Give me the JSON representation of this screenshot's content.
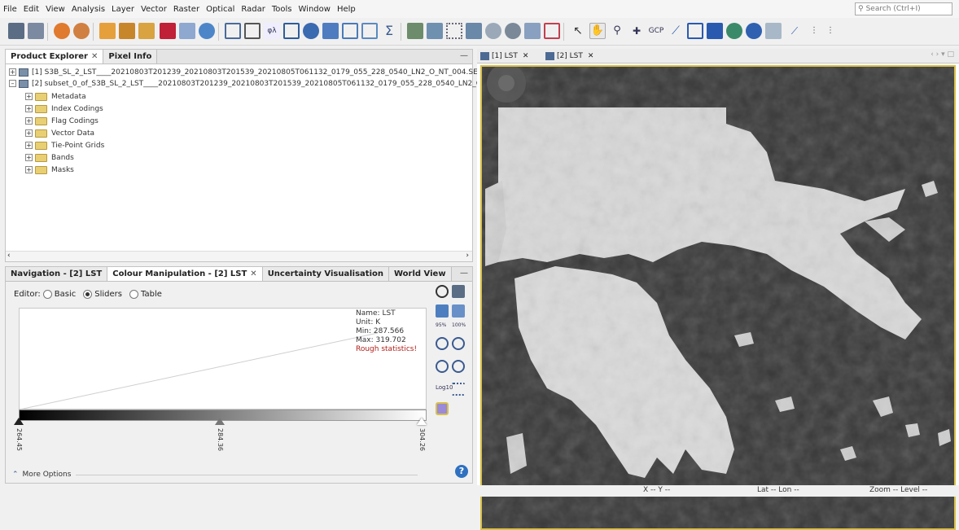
{
  "menu": [
    "File",
    "Edit",
    "View",
    "Analysis",
    "Layer",
    "Vector",
    "Raster",
    "Optical",
    "Radar",
    "Tools",
    "Window",
    "Help"
  ],
  "search_placeholder": "Search (Ctrl+I)",
  "explorer": {
    "tabs": [
      "Product Explorer",
      "Pixel Info"
    ],
    "products": [
      "[1] S3B_SL_2_LST____20210803T201239_20210803T201539_20210805T061132_0179_055_228_0540_LN2_O_NT_004.SEN3",
      "[2] subset_0_of_S3B_SL_2_LST____20210803T201239_20210803T201539_20210805T061132_0179_055_228_0540_LN2_O_N"
    ],
    "children": [
      "Metadata",
      "Index Codings",
      "Flag Codings",
      "Vector Data",
      "Tie-Point Grids",
      "Bands",
      "Masks"
    ]
  },
  "colour": {
    "tabs": [
      "Navigation - [2] LST",
      "Colour Manipulation - [2] LST",
      "Uncertainty Visualisation",
      "World View"
    ],
    "editor_label": "Editor:",
    "editor_options": [
      "Basic",
      "Sliders",
      "Table"
    ],
    "selected_editor": "Sliders",
    "stats": {
      "name": "Name: LST",
      "unit": "Unit: K",
      "min": "Min: 287.566",
      "max": "Max: 319.702",
      "rough": "Rough statistics!"
    },
    "sliders": [
      "264.45",
      "284.36",
      "304.26"
    ],
    "more_options": "More Options",
    "tool_labels": {
      "p95": "95%",
      "p100": "100%",
      "log": "Log10"
    }
  },
  "view": {
    "tabs": [
      "[1] LST",
      "[2] LST"
    ]
  },
  "status": {
    "xy": "X -- Y --",
    "latlon": "Lat -- Lon --",
    "zoom": "Zoom -- Level --"
  },
  "colors": {
    "accent_border": "#d8c04a",
    "nodata": "#383838",
    "warning_text": "#b0201a"
  }
}
